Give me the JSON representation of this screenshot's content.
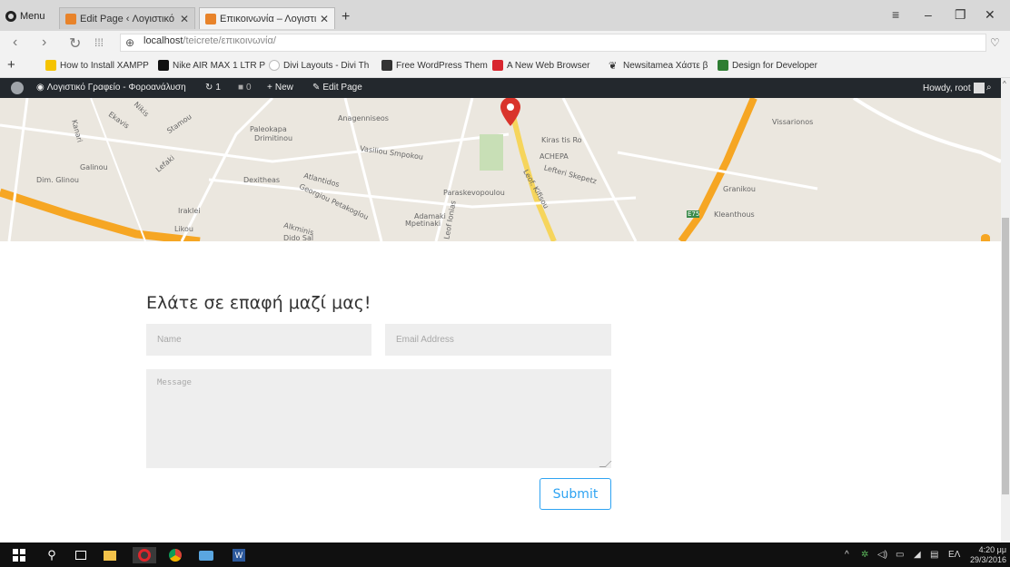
{
  "browser": {
    "menu_label": "Menu",
    "tabs": [
      {
        "title": "Edit Page ‹ Λογιστικό Γραφ",
        "active": false
      },
      {
        "title": "Επικοινωνία – Λογιστικό Γ",
        "active": true
      }
    ],
    "new_tab_symbol": "+",
    "url_host": "localhost",
    "url_path": "/teicrete/επικοινωνία/",
    "bookmarks": [
      {
        "label": "How to Install XAMPP",
        "icon_color": "#f5c300"
      },
      {
        "label": "Nike AIR MAX 1 LTR P",
        "icon_color": "#111111"
      },
      {
        "label": "Divi Layouts - Divi Th",
        "icon_color": "#bbbbbb"
      },
      {
        "label": "Free WordPress Them",
        "icon_color": "#333333"
      },
      {
        "label": "A New Web Browser",
        "icon_color": "#d8262f"
      },
      {
        "label": "Newsitamea Χάστε β",
        "icon_color": "#333333"
      },
      {
        "label": "Design for Developer",
        "icon_color": "#2e7d32"
      }
    ]
  },
  "adminbar": {
    "site_name": "Λογιστικό Γραφείο - Φοροανάλυση",
    "updates_count": "1",
    "comments_count": "0",
    "new_label": "New",
    "edit_label": "Edit Page",
    "howdy": "Howdy, root"
  },
  "map": {
    "labels": [
      "Nikis",
      "Ekavis",
      "Kanari",
      "Stamou",
      "Paleokapa",
      "Drimitinou",
      "Anagenniseos",
      "Vasiliou Smpokou",
      "Kiras tis Ro",
      "ACHEPA",
      "Lefteri Skepetz",
      "Vissarionos",
      "Galinou",
      "Dim. Glinou",
      "Dexitheas",
      "Atlantidos",
      "Georgiou Petakoglou",
      "Paraskevopoulou",
      "Adamaki",
      "Mpetinaki",
      "Alkminis",
      "Dido Sal",
      "Granikou",
      "Kleanthous",
      "E75",
      "Iraklei",
      "Likou",
      "Lefaki",
      "Leof Ionias",
      "Leof. Kifisou"
    ],
    "marker_color": "#d9342b"
  },
  "form": {
    "title": "Ελάτε σε επαφή μαζί μας!",
    "name_placeholder": "Name",
    "email_placeholder": "Email Address",
    "message_placeholder": "Message",
    "submit_label": "Submit",
    "accent": "#2ea3f2"
  },
  "taskbar": {
    "lang": "ΕΛ",
    "time": "4:20 μμ",
    "date": "29/3/2016"
  }
}
